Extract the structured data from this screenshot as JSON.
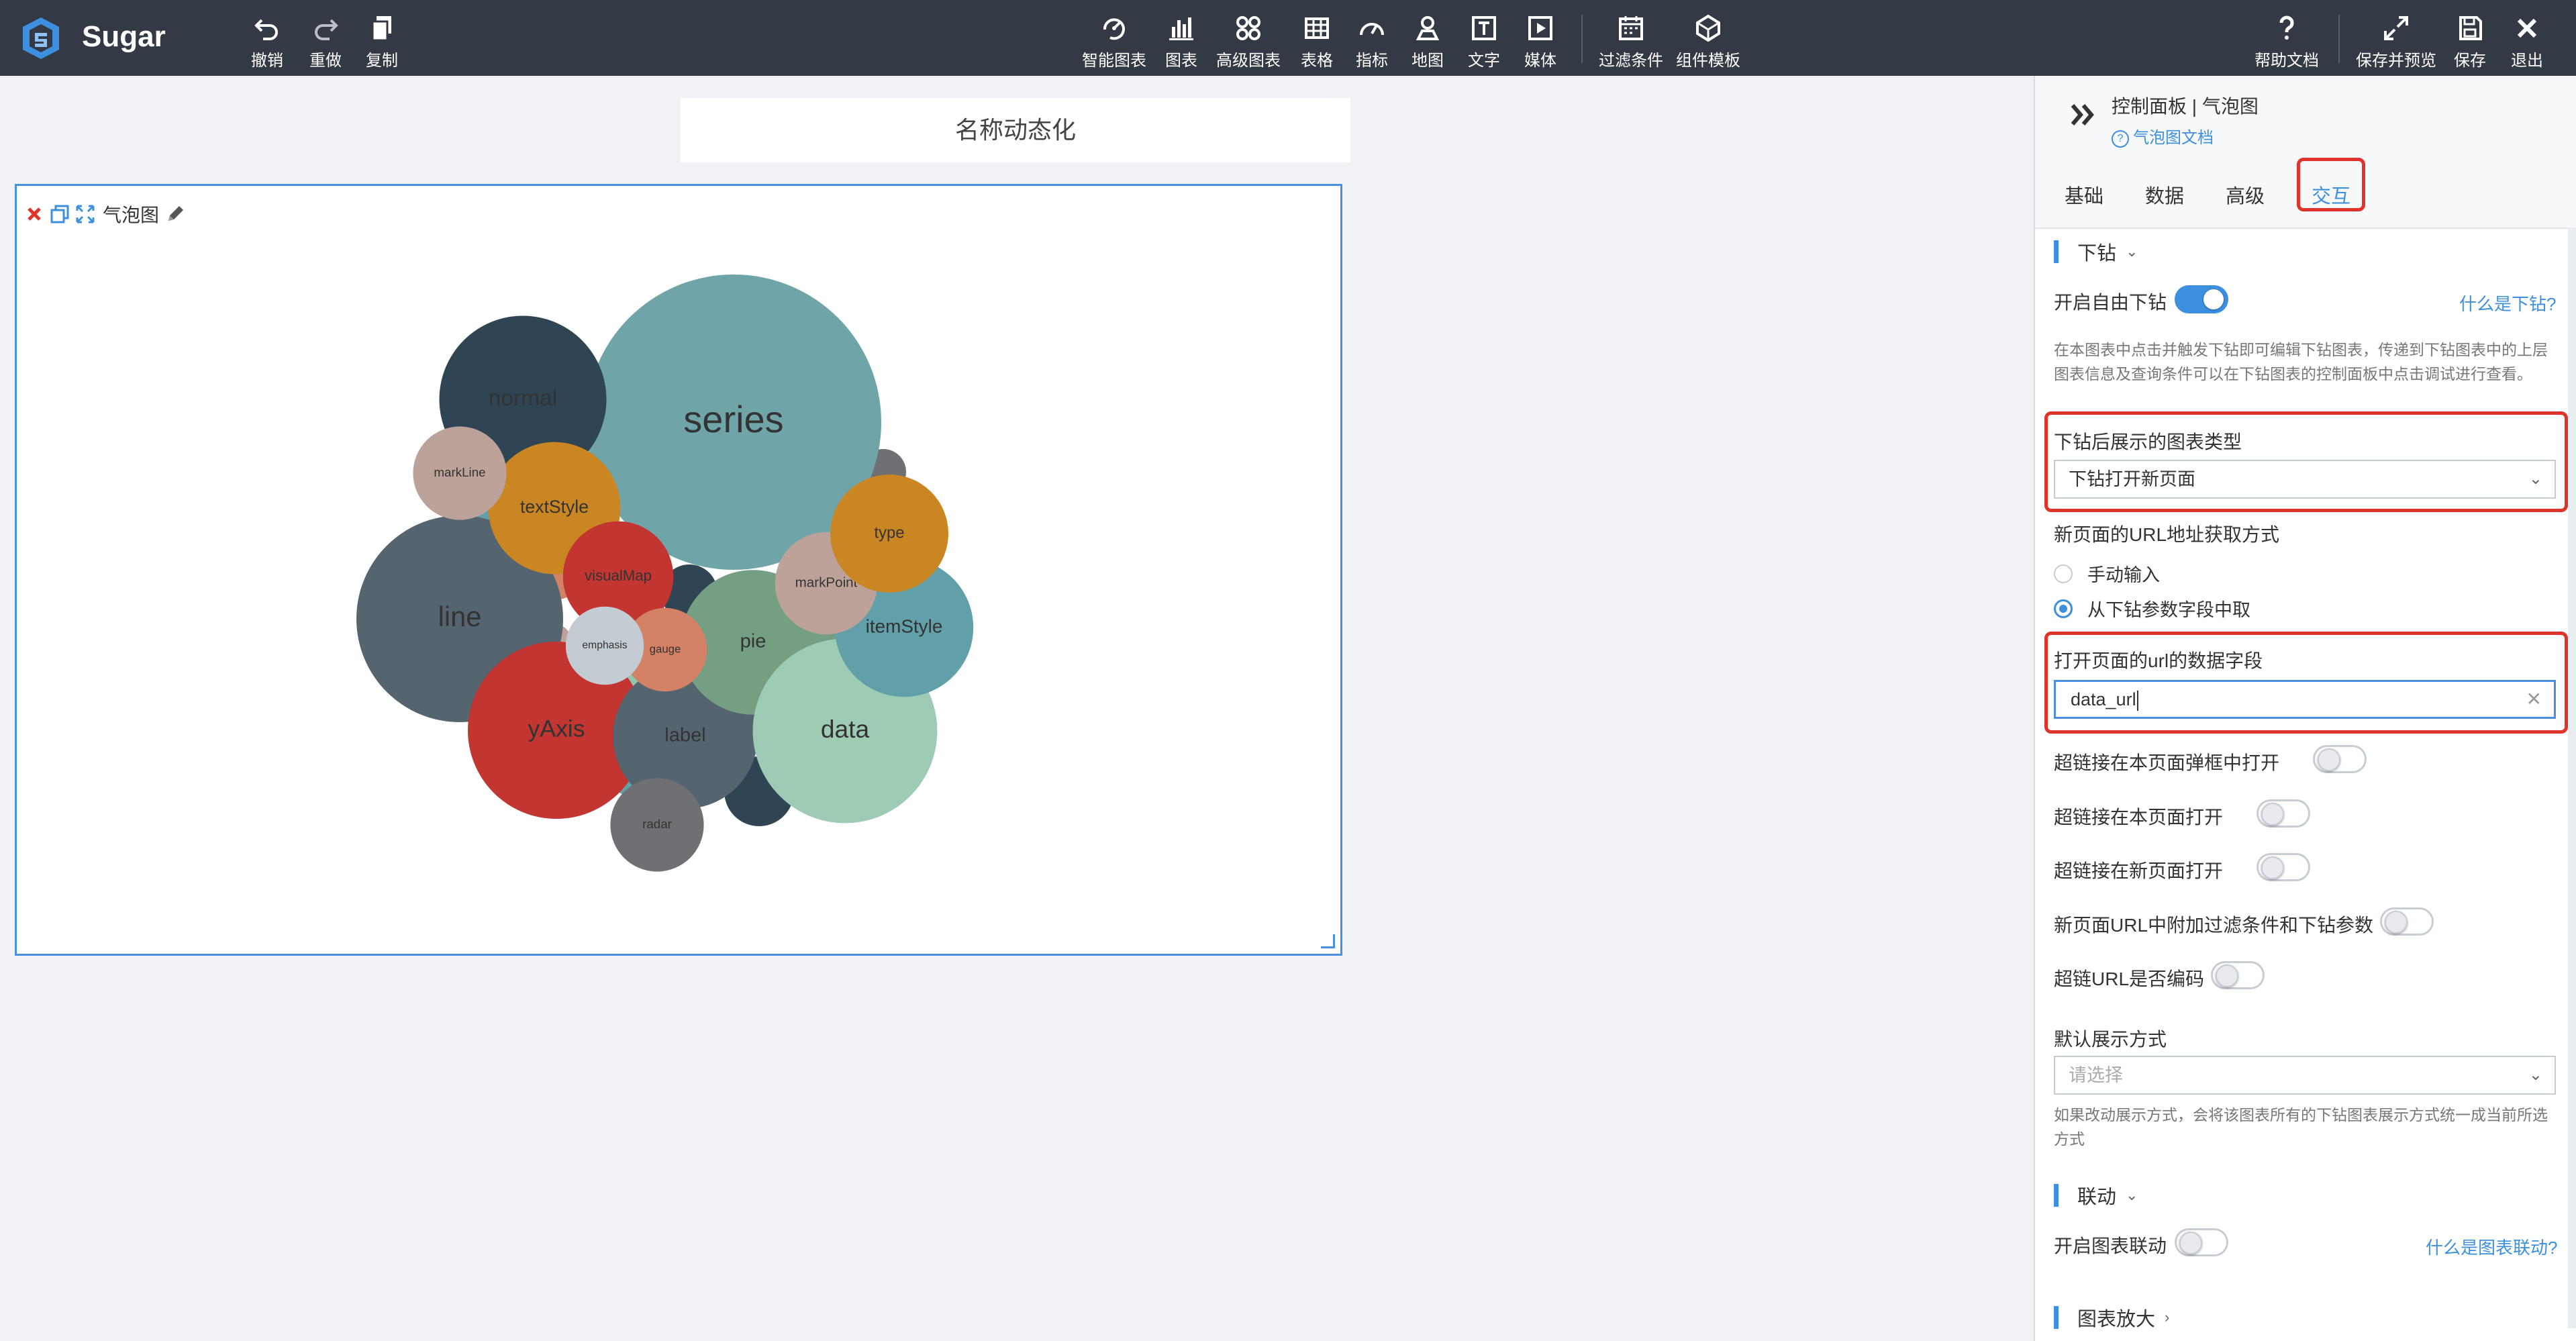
{
  "app": {
    "brand": "Sugar",
    "accent_color": "#3d8fe0",
    "toolbar_color": "#343a45"
  },
  "toolbar": {
    "left": [
      {
        "label": "撤销",
        "icon": "undo-icon"
      },
      {
        "label": "重做",
        "icon": "redo-icon"
      },
      {
        "label": "复制",
        "icon": "copy-icon"
      }
    ],
    "center": [
      {
        "label": "智能图表",
        "icon": "smart-chart-icon"
      },
      {
        "label": "图表",
        "icon": "bar-chart-icon"
      },
      {
        "label": "高级图表",
        "icon": "advanced-chart-icon"
      },
      {
        "label": "表格",
        "icon": "table-icon"
      },
      {
        "label": "指标",
        "icon": "gauge-icon"
      },
      {
        "label": "地图",
        "icon": "map-pin-icon"
      },
      {
        "label": "文字",
        "icon": "text-icon"
      },
      {
        "label": "媒体",
        "icon": "media-play-icon"
      },
      {
        "label": "过滤条件",
        "icon": "filter-calendar-icon"
      },
      {
        "label": "组件模板",
        "icon": "component-template-icon"
      }
    ],
    "right": [
      {
        "label": "帮助文档",
        "icon": "question-icon"
      },
      {
        "label": "保存并预览",
        "icon": "expand-icon"
      },
      {
        "label": "保存",
        "icon": "save-icon"
      },
      {
        "label": "退出",
        "icon": "close-icon"
      }
    ]
  },
  "canvas": {
    "title": "名称动态化",
    "widget_name": "气泡图"
  },
  "chart_data": {
    "type": "bubble",
    "bubbles": [
      {
        "label": "series",
        "value": 100,
        "color": "#6fa5a8"
      },
      {
        "label": "normal",
        "value": 32,
        "color": "#2f4554"
      },
      {
        "label": "line",
        "value": 49,
        "color": "#546570"
      },
      {
        "label": "textStyle",
        "value": 20,
        "color": "#ca8622"
      },
      {
        "label": "visualMap",
        "value": 14,
        "color": "#c23531"
      },
      {
        "label": "yAxis",
        "value": 36,
        "color": "#c23531"
      },
      {
        "label": "label",
        "value": 24,
        "color": "#546570"
      },
      {
        "label": "pie",
        "value": 24,
        "color": "#749f83"
      },
      {
        "label": "data",
        "value": 39,
        "color": "#9dcbb4"
      },
      {
        "label": "itemStyle",
        "value": 22,
        "color": "#61a0a8"
      },
      {
        "label": "markPoint",
        "value": 12,
        "color": "#bda29a"
      },
      {
        "label": "type",
        "value": 16,
        "color": "#ca8622"
      },
      {
        "label": "markLine",
        "value": 10,
        "color": "#bda29a"
      },
      {
        "label": "radar",
        "value": 10,
        "color": "#6e7074"
      },
      {
        "label": "gauge",
        "value": 8,
        "color": "#d48265"
      },
      {
        "label": "emphasis",
        "value": 7,
        "color": "#c4ccd3"
      }
    ]
  },
  "panel": {
    "title": "控制面板 | 气泡图",
    "doc_link": "气泡图文档",
    "tabs": [
      "基础",
      "数据",
      "高级",
      "交互"
    ],
    "active_tab": "交互",
    "drill": {
      "section_title": "下钻",
      "enable_label": "开启自由下钻",
      "enable_on": true,
      "help": "什么是下钻?",
      "description": "在本图表中点击并触发下钻即可编辑下钻图表，传递到下钻图表中的上层图表信息及查询条件可以在下钻图表的控制面板中点击调试进行查看。",
      "chart_type_label": "下钻后展示的图表类型",
      "chart_type_value": "下钻打开新页面",
      "url_source_label": "新页面的URL地址获取方式",
      "url_options": [
        "手动输入",
        "从下钻参数字段中取"
      ],
      "url_selected": "从下钻参数字段中取",
      "url_field_label": "打开页面的url的数据字段",
      "url_field_value": "data_url",
      "toggles": [
        {
          "label": "超链接在本页面弹框中打开",
          "on": false
        },
        {
          "label": "超链接在本页面打开",
          "on": false
        },
        {
          "label": "超链接在新页面打开",
          "on": false
        },
        {
          "label": "新页面URL中附加过滤条件和下钻参数",
          "on": false
        },
        {
          "label": "超链URL是否编码",
          "on": false
        }
      ],
      "display_mode_label": "默认展示方式",
      "display_mode_placeholder": "请选择",
      "display_mode_note": "如果改动展示方式，会将该图表所有的下钻图表展示方式统一成当前所选方式"
    },
    "link": {
      "section_title": "联动",
      "enable_label": "开启图表联动",
      "enable_on": false,
      "help": "什么是图表联动?"
    },
    "zoom": {
      "section_title": "图表放大"
    }
  }
}
